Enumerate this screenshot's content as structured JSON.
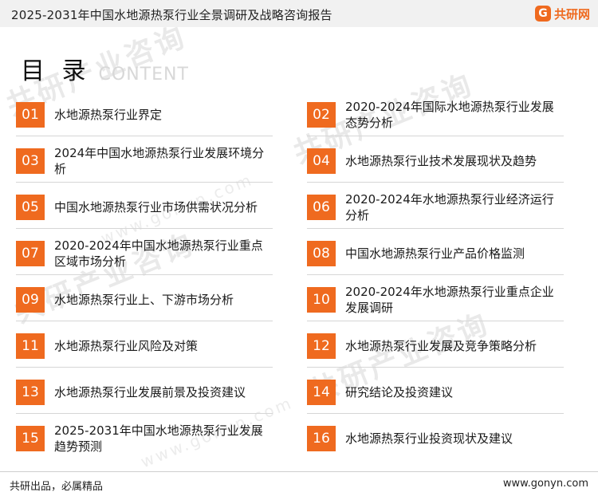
{
  "header": {
    "title": "2025-2031年中国水地源热泵行业全景调研及战略咨询报告",
    "logo_mark": "G",
    "logo_text": "共研网"
  },
  "heading": {
    "cn": "目 录",
    "en": "CONTENT"
  },
  "watermark": {
    "text": "共研产业咨询",
    "url": "www.gonyn.com"
  },
  "toc": [
    {
      "num": "01",
      "title": "水地源热泵行业界定"
    },
    {
      "num": "02",
      "title": "2020-2024年国际水地源热泵行业发展态势分析"
    },
    {
      "num": "03",
      "title": "2024年中国水地源热泵行业发展环境分析"
    },
    {
      "num": "04",
      "title": "水地源热泵行业技术发展现状及趋势"
    },
    {
      "num": "05",
      "title": "中国水地源热泵行业市场供需状况分析"
    },
    {
      "num": "06",
      "title": "2020-2024年水地源热泵行业经济运行分析"
    },
    {
      "num": "07",
      "title": "2020-2024年中国水地源热泵行业重点区域市场分析"
    },
    {
      "num": "08",
      "title": "中国水地源热泵行业产品价格监测"
    },
    {
      "num": "09",
      "title": "水地源热泵行业上、下游市场分析"
    },
    {
      "num": "10",
      "title": "2020-2024年水地源热泵行业重点企业发展调研"
    },
    {
      "num": "11",
      "title": "水地源热泵行业风险及对策"
    },
    {
      "num": "12",
      "title": "水地源热泵行业发展及竞争策略分析"
    },
    {
      "num": "13",
      "title": "水地源热泵行业发展前景及投资建议"
    },
    {
      "num": "14",
      "title": "研究结论及投资建议"
    },
    {
      "num": "15",
      "title": "2025-2031年中国水地源热泵行业发展趋势预测"
    },
    {
      "num": "16",
      "title": "水地源热泵行业投资现状及建议"
    }
  ],
  "footer": {
    "left": "共研出品，必属精品",
    "right": "www.gonyn.com"
  },
  "colors": {
    "accent": "#ef6a1f",
    "topbar": "#f1f1f1"
  }
}
